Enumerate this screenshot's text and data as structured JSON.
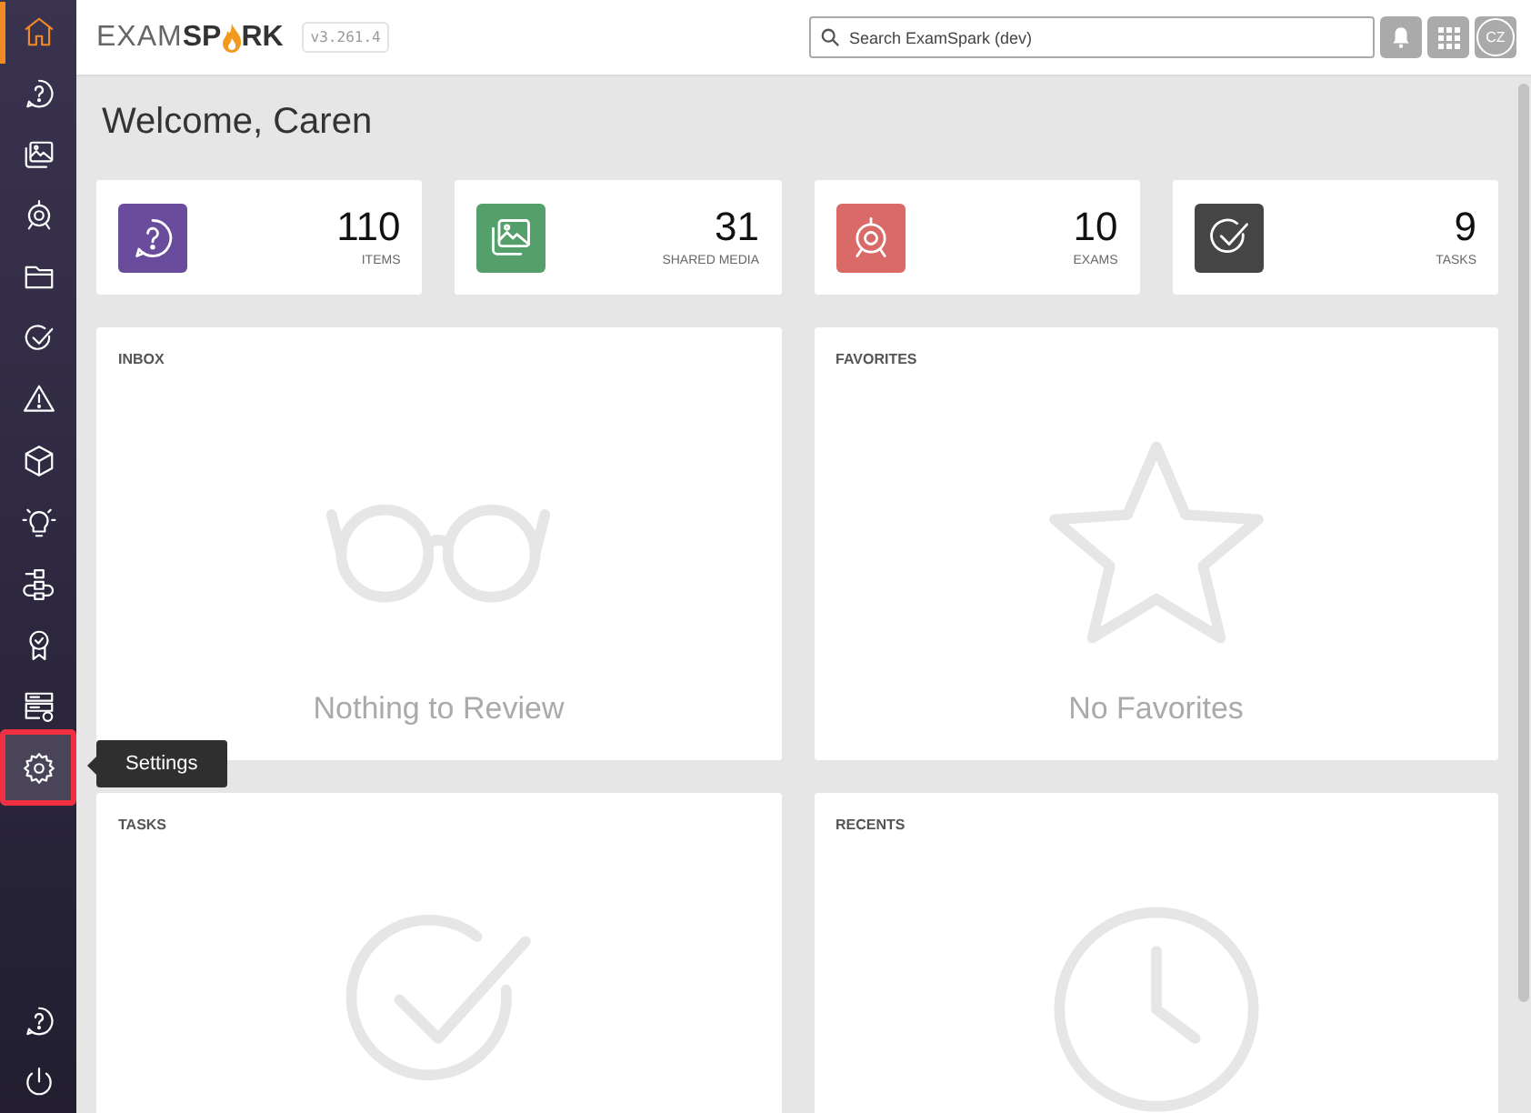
{
  "sidebar": {
    "items": [
      {
        "kind": "home",
        "selected": true,
        "highlighted": false
      },
      {
        "kind": "help",
        "selected": false,
        "highlighted": false
      },
      {
        "kind": "media",
        "selected": false,
        "highlighted": false
      },
      {
        "kind": "exam",
        "selected": false,
        "highlighted": false
      },
      {
        "kind": "folder",
        "selected": false,
        "highlighted": false
      },
      {
        "kind": "check",
        "selected": false,
        "highlighted": false
      },
      {
        "kind": "warning",
        "selected": false,
        "highlighted": false
      },
      {
        "kind": "cube",
        "selected": false,
        "highlighted": false
      },
      {
        "kind": "bulb",
        "selected": false,
        "highlighted": false
      },
      {
        "kind": "flow",
        "selected": false,
        "highlighted": false
      },
      {
        "kind": "award",
        "selected": false,
        "highlighted": false
      },
      {
        "kind": "server",
        "selected": false,
        "highlighted": false
      },
      {
        "kind": "gear",
        "selected": false,
        "highlighted": true
      }
    ],
    "bottom_items": [
      {
        "kind": "help",
        "selected": false,
        "highlighted": false
      },
      {
        "kind": "power",
        "selected": false,
        "highlighted": false
      }
    ]
  },
  "tooltip": {
    "text": "Settings"
  },
  "header": {
    "logo": [
      "EXAM",
      "SP",
      "RK"
    ],
    "version": "v3.261.4",
    "search": {
      "placeholder": "Search ExamSpark (dev)"
    },
    "avatar": "CZ"
  },
  "welcome": "Welcome, Caren",
  "stats": [
    {
      "kind": "help",
      "color": "#6a4c9c",
      "value": "110",
      "label": "ITEMS"
    },
    {
      "kind": "media",
      "color": "#55a06a",
      "value": "31",
      "label": "SHARED MEDIA"
    },
    {
      "kind": "exam",
      "color": "#d96a67",
      "value": "10",
      "label": "EXAMS"
    },
    {
      "kind": "check",
      "color": "#454545",
      "value": "9",
      "label": "TASKS"
    }
  ],
  "panels": [
    {
      "title": "INBOX",
      "kind": "glasses",
      "empty_text": "Nothing to Review"
    },
    {
      "title": "FAVORITES",
      "kind": "star",
      "empty_text": "No Favorites"
    },
    {
      "title": "TASKS",
      "kind": "check"
    },
    {
      "title": "RECENTS",
      "kind": "clock"
    }
  ]
}
